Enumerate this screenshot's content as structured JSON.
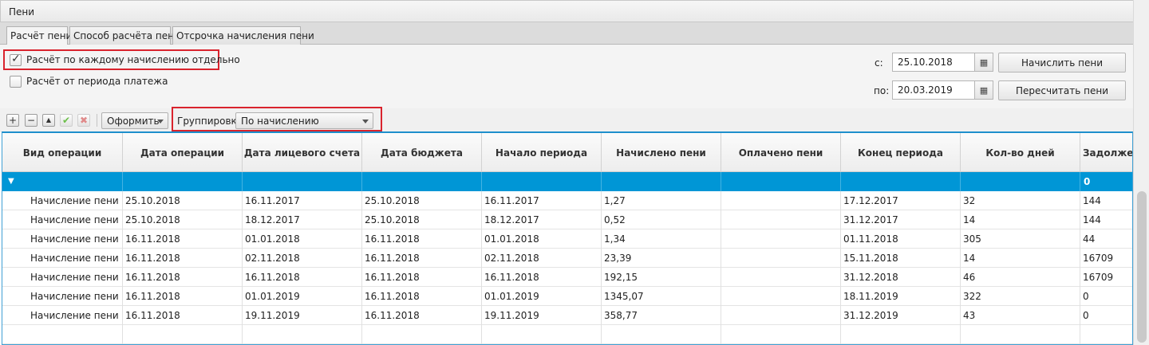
{
  "window": {
    "title": "Пени"
  },
  "tabs": [
    {
      "label": "Расчёт пени",
      "active": true
    },
    {
      "label": "Способ расчёта пени",
      "active": false
    },
    {
      "label": "Отсрочка начисления пени",
      "active": false
    }
  ],
  "options": {
    "per_accrual": {
      "label": "Расчёт по каждому начислению отдельно",
      "checked": true
    },
    "from_payment_period": {
      "label": "Расчёт от периода платежа",
      "checked": false
    }
  },
  "period": {
    "from_label": "с:",
    "from_value": "25.10.2018",
    "to_label": "по:",
    "to_value": "20.03.2019"
  },
  "actions": {
    "calculate": "Начислить пени",
    "recalculate": "Пересчитать пени"
  },
  "toolbar": {
    "add_icon": "plus-icon",
    "remove_icon": "minus-icon",
    "up_icon": "arrow-up-icon",
    "confirm_icon": "check-icon",
    "cancel_icon": "cross-icon",
    "format_label": "Оформить",
    "grouping_label": "Группировка",
    "grouping_value": "По начислению"
  },
  "table": {
    "columns": [
      "Вид операции",
      "Дата операции",
      "Дата лицевого счета",
      "Дата бюджета",
      "Начало периода",
      "Начислено пени",
      "Оплачено пени",
      "Конец периода",
      "Кол-во дней",
      "Задолжен"
    ],
    "group_row": {
      "toggle": "▼",
      "debt": "0"
    },
    "rows": [
      [
        "Начисление пени",
        "25.10.2018",
        "16.11.2017",
        "25.10.2018",
        "16.11.2017",
        "1,27",
        "",
        "17.12.2017",
        "32",
        "144"
      ],
      [
        "Начисление пени",
        "25.10.2018",
        "18.12.2017",
        "25.10.2018",
        "18.12.2017",
        "0,52",
        "",
        "31.12.2017",
        "14",
        "144"
      ],
      [
        "Начисление пени",
        "16.11.2018",
        "01.01.2018",
        "16.11.2018",
        "01.01.2018",
        "1,34",
        "",
        "01.11.2018",
        "305",
        "44"
      ],
      [
        "Начисление пени",
        "16.11.2018",
        "02.11.2018",
        "16.11.2018",
        "02.11.2018",
        "23,39",
        "",
        "15.11.2018",
        "14",
        "16709"
      ],
      [
        "Начисление пени",
        "16.11.2018",
        "16.11.2018",
        "16.11.2018",
        "16.11.2018",
        "192,15",
        "",
        "31.12.2018",
        "46",
        "16709"
      ],
      [
        "Начисление пени",
        "16.11.2018",
        "01.01.2019",
        "16.11.2018",
        "01.01.2019",
        "1345,07",
        "",
        "18.11.2019",
        "322",
        "0"
      ],
      [
        "Начисление пени",
        "16.11.2018",
        "19.11.2019",
        "16.11.2018",
        "19.11.2019",
        "358,77",
        "",
        "31.12.2019",
        "43",
        "0"
      ]
    ]
  },
  "colors": {
    "group_row": "#0096d6",
    "highlight_border": "#d9232d"
  }
}
